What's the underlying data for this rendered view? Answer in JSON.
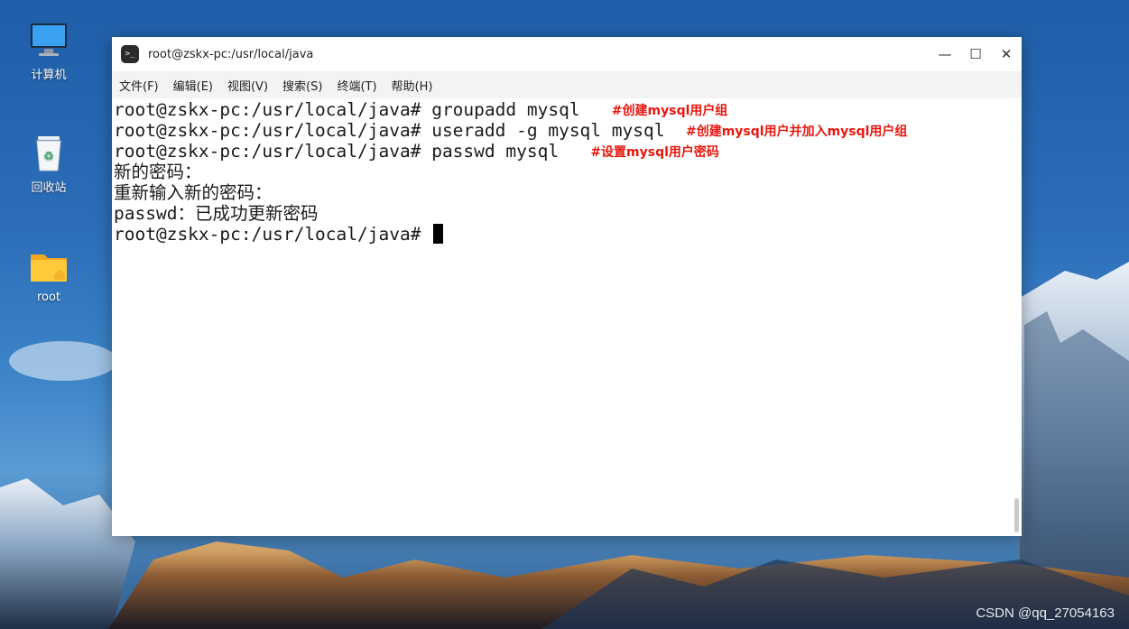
{
  "desktop": {
    "icons": [
      {
        "label": "计算机"
      },
      {
        "label": "回收站"
      },
      {
        "label": "root"
      }
    ],
    "watermark": "CSDN @qq_27054163"
  },
  "window": {
    "title": "root@zskx-pc:/usr/local/java",
    "controls": {
      "minimize": "—",
      "maximize": "☐",
      "close": "✕"
    },
    "menu": [
      "文件(F)",
      "编辑(E)",
      "视图(V)",
      "搜索(S)",
      "终端(T)",
      "帮助(H)"
    ]
  },
  "terminal": {
    "lines": [
      {
        "text": "root@zskx-pc:/usr/local/java# groupadd mysql",
        "comment": "#创建mysql用户组"
      },
      {
        "text": "root@zskx-pc:/usr/local/java# useradd -g mysql mysql",
        "comment": "#创建mysql用户并加入mysql用户组"
      },
      {
        "text": "root@zskx-pc:/usr/local/java# passwd mysql",
        "comment": "#设置mysql用户密码"
      },
      {
        "text": "新的密码：",
        "comment": ""
      },
      {
        "text": "重新输入新的密码：",
        "comment": ""
      },
      {
        "text": "passwd：已成功更新密码",
        "comment": ""
      },
      {
        "text": "root@zskx-pc:/usr/local/java# ",
        "comment": ""
      }
    ]
  }
}
